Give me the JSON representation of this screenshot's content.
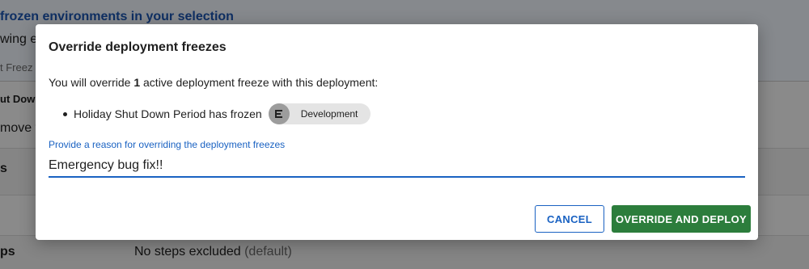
{
  "background": {
    "title": "frozen environments in your selection",
    "line1": "wing en",
    "line2": "t Freez",
    "line3": "ut Down",
    "line4": "move f",
    "row_a_label": "s",
    "row_c_label": "ps",
    "steps_value": "No steps excluded",
    "steps_default": "(default)"
  },
  "modal": {
    "title": "Override deployment freezes",
    "intro_prefix": "You will override",
    "intro_count": "1",
    "intro_suffix": "active deployment freeze with this deployment:",
    "freezes": [
      {
        "text": "Holiday Shut Down Period has frozen",
        "environment": "Development",
        "environment_icon": "environment-icon"
      }
    ],
    "reason_label": "Provide a reason for overriding the deployment freezes",
    "reason_value": "Emergency bug fix!!",
    "cancel_label": "CANCEL",
    "override_label": "OVERRIDE AND DEPLOY"
  },
  "colors": {
    "accent_blue": "#1a62c2",
    "primary_green": "#2c7d3c",
    "overlay": "#7b7b7b"
  }
}
